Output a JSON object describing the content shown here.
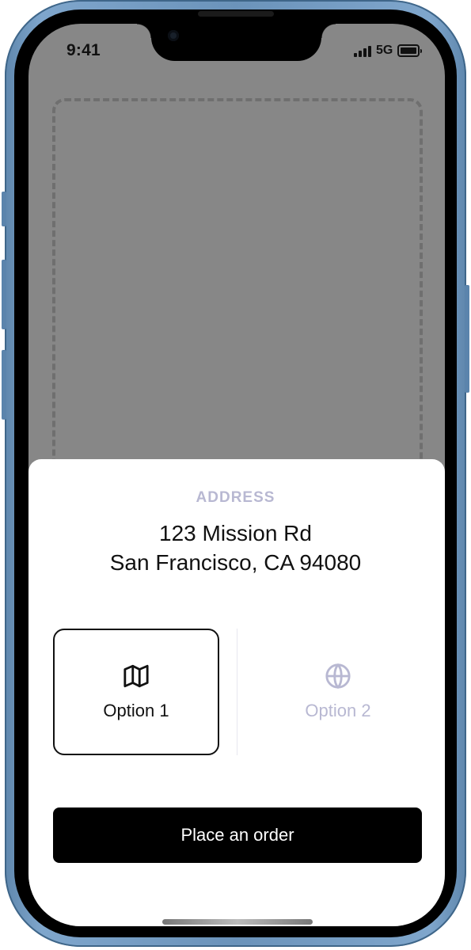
{
  "status_bar": {
    "time": "9:41",
    "network": "5G"
  },
  "sheet": {
    "label": "ADDRESS",
    "address_line1": "123 Mission Rd",
    "address_line2": "San Francisco, CA 94080",
    "options": [
      {
        "label": "Option 1",
        "icon": "map-icon",
        "selected": true
      },
      {
        "label": "Option 2",
        "icon": "globe-icon",
        "selected": false
      }
    ],
    "cta_label": "Place an order"
  },
  "colors": {
    "frame": "#6b93ba",
    "screen_background": "#878787",
    "accent_muted": "#b8b8d2",
    "button": "#000000",
    "button_text": "#ffffff"
  }
}
